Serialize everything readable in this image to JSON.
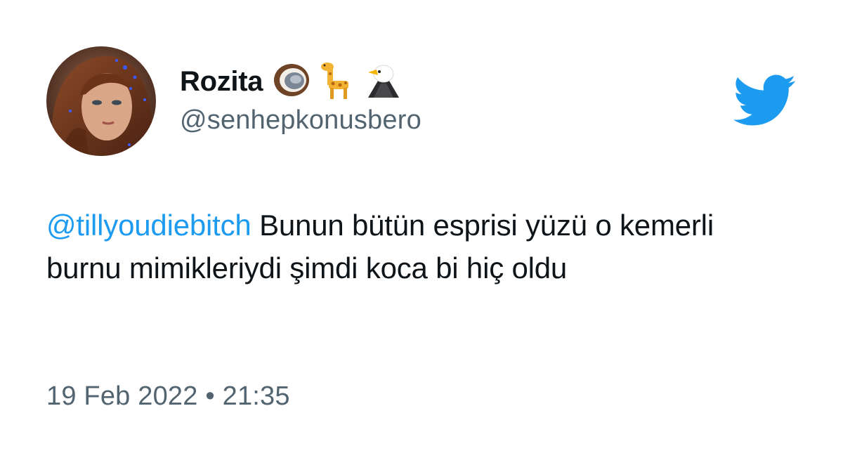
{
  "tweet": {
    "author": {
      "display_name": "Rozita",
      "handle": "@senhepkonusbero",
      "name_emojis": [
        "coconut-icon",
        "giraffe-icon",
        "eagle-icon"
      ],
      "avatar": "avatar-photo"
    },
    "body": {
      "mention": "@tillyoudiebitch",
      "text": " Bunun bütün esprisi yüzü o kemerli burnu mimikleriydi şimdi koca bi hiç oldu"
    },
    "timestamp": "19 Feb 2022 • 21:35"
  },
  "brand": {
    "logo": "twitter-bird-icon",
    "accent_color": "#1d9bf0",
    "text_color": "#0f1419",
    "secondary_color": "#536471"
  }
}
